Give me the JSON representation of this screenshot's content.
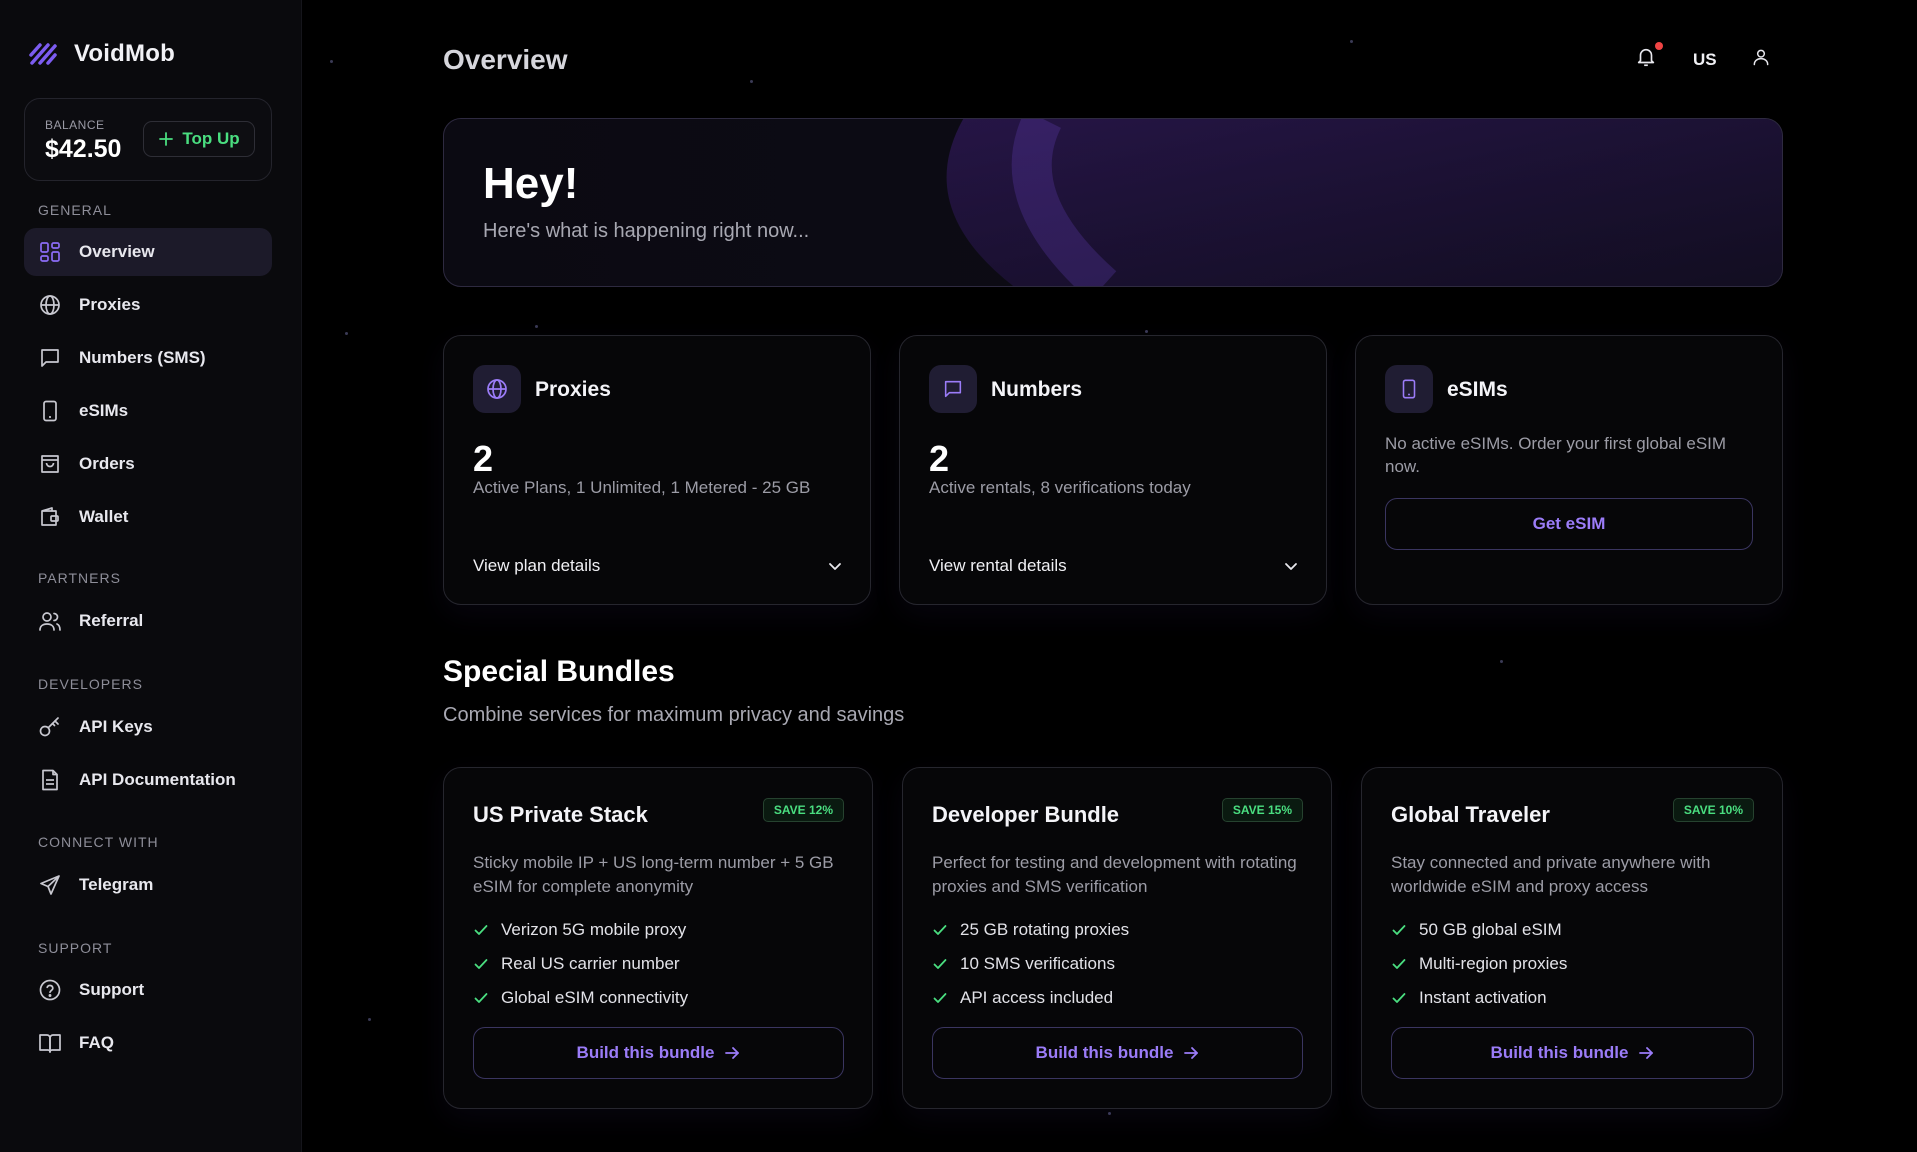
{
  "brand": {
    "name": "VoidMob"
  },
  "balance": {
    "label": "BALANCE",
    "value": "$42.50",
    "topup_label": "Top Up"
  },
  "sidebar": {
    "sections": {
      "general": "GENERAL",
      "partners": "PARTNERS",
      "developers": "DEVELOPERS",
      "connect": "CONNECT WITH",
      "support": "SUPPORT"
    },
    "items": {
      "overview": "Overview",
      "proxies": "Proxies",
      "numbers": "Numbers (SMS)",
      "esims": "eSIMs",
      "orders": "Orders",
      "wallet": "Wallet",
      "referral": "Referral",
      "api_keys": "API Keys",
      "api_docs": "API Documentation",
      "telegram": "Telegram",
      "support": "Support",
      "faq": "FAQ"
    },
    "active": "overview"
  },
  "header": {
    "title": "Overview",
    "language": "US"
  },
  "hero": {
    "title": "Hey!",
    "subtitle": "Here's what is happening right now..."
  },
  "cards": {
    "proxies": {
      "title": "Proxies",
      "count": "2",
      "desc": "Active Plans, 1 Unlimited, 1 Metered - 25 GB",
      "link": "View plan details"
    },
    "numbers": {
      "title": "Numbers",
      "count": "2",
      "desc": "Active rentals, 8 verifications today",
      "link": "View rental details"
    },
    "esims": {
      "title": "eSIMs",
      "desc": "No active eSIMs. Order your first global eSIM now.",
      "button": "Get eSIM"
    }
  },
  "bundles": {
    "title": "Special Bundles",
    "subtitle": "Combine services for maximum privacy and savings",
    "items": [
      {
        "name": "US Private Stack",
        "badge": "SAVE 12%",
        "desc": "Sticky mobile IP + US long-term number + 5 GB eSIM for complete anonymity",
        "features": [
          "Verizon 5G mobile proxy",
          "Real US carrier number",
          "Global eSIM connectivity"
        ],
        "button": "Build this bundle"
      },
      {
        "name": "Developer Bundle",
        "badge": "SAVE 15%",
        "desc": "Perfect for testing and development with rotating proxies and SMS verification",
        "features": [
          "25 GB rotating proxies",
          "10 SMS verifications",
          "API access included"
        ],
        "button": "Build this bundle"
      },
      {
        "name": "Global Traveler",
        "badge": "SAVE 10%",
        "desc": "Stay connected and private anywhere with worldwide eSIM and proxy access",
        "features": [
          "50 GB global eSIM",
          "Multi-region proxies",
          "Instant activation"
        ],
        "button": "Build this bundle"
      }
    ]
  },
  "colors": {
    "accent": "#8b6cf6",
    "success": "#4ade80",
    "notification": "#ef4444",
    "background": "#000000",
    "sidebar": "#0a0a0d"
  }
}
